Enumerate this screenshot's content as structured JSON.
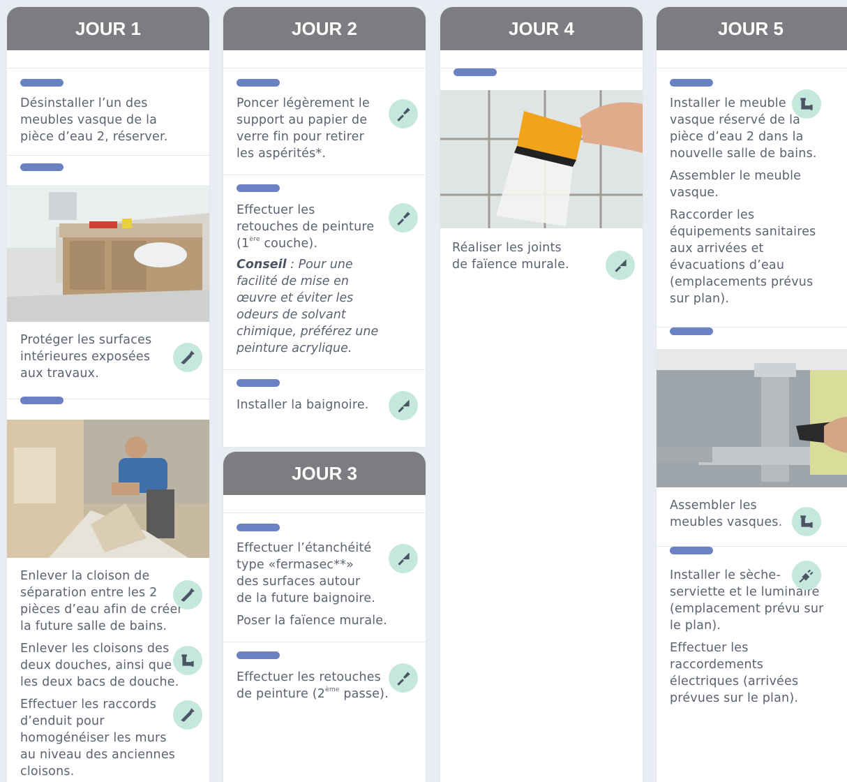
{
  "columns": [
    {
      "title": "JOUR 1"
    },
    {
      "title": "JOUR 2"
    },
    {
      "title": "JOUR 4"
    },
    {
      "title": "JOUR 5"
    },
    {
      "title": "JOUR 3"
    }
  ],
  "day1": {
    "t1": "Désinstaller l’un des meubles vasque de la pièce d’eau 2, réserver.",
    "t2": "Protéger les surfaces intérieures exposées aux travaux.",
    "t3": "Enlever la cloison de séparation entre les 2 pièces d’eau afin de créer la future salle de bains.",
    "t4": "Enlever les cloisons des deux douches, ainsi que les deux bacs de douche.",
    "t5": "Effectuer les raccords d’enduit pour homogénéiser les murs au niveau des anciennes cloisons."
  },
  "day2": {
    "t1": "Poncer légèrement le support au papier de verre fin pour retirer les aspérités*.",
    "t2a": "Effectuer les retouches de peinture (1",
    "t2sup": "ère",
    "t2b": " couche).",
    "tip_label": "Conseil",
    "tip_text": " : Pour une facilité de mise en œuvre et éviter les odeurs de solvant chimique, préférez une peinture acrylique.",
    "t3": "Installer la baignoire."
  },
  "day3": {
    "t1": "Effectuer l’étanchéité type «fermasec**» des surfaces autour de la future baignoire.",
    "t2": "Poser la faïence murale.",
    "t3a": "Effectuer les retouches de peinture (2",
    "t3sup": "ème",
    "t3b": " passe)."
  },
  "day4": {
    "t1": "Réaliser les joints de faïence murale."
  },
  "day5": {
    "t1": "Installer le meuble vasque réservé de la pièce d’eau 2 dans la nouvelle salle de bains.",
    "t2": "Assembler le meuble vasque.",
    "t3": "Raccorder les équipements sanitaires aux arrivées et évacuations d’eau (emplacements prévus sur plan).",
    "t4": "Assembler les meubles vasques.",
    "t5": "Installer le sèche-serviette et le luminaire (emplacement prévu sur le plan).",
    "t6": "Effectuer les raccordements électriques (arrivées prévues sur le plan)."
  },
  "colors": {
    "header": "#7c7d80",
    "pill": "#6b82c2",
    "icon_bg": "#c4e8dc",
    "icon_fg": "#4b5563"
  },
  "icons": [
    "saw-icon",
    "brush-icon",
    "trowel-icon",
    "pipe-icon",
    "plug-icon"
  ]
}
